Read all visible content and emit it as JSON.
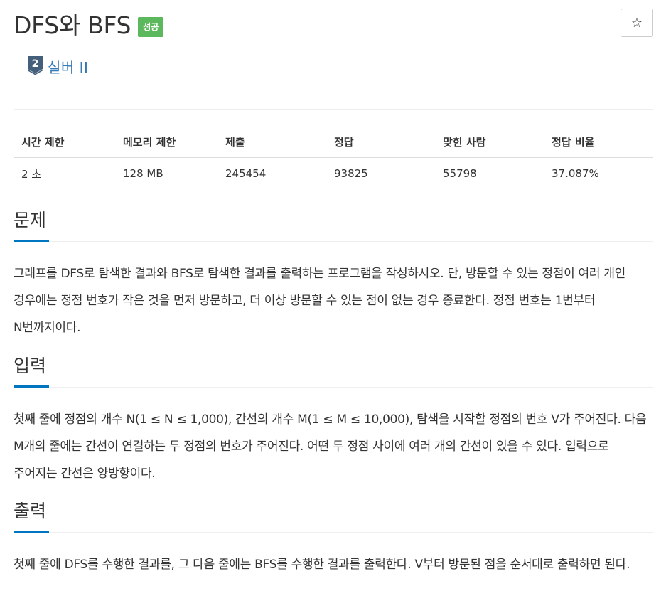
{
  "problem": {
    "title": "DFS와 BFS",
    "result_badge": "성공",
    "tier": "실버 II",
    "tier_number": "2",
    "star_label": "☆"
  },
  "info_table": {
    "headers": [
      "시간 제한",
      "메모리 제한",
      "제출",
      "정답",
      "맞힌 사람",
      "정답 비율"
    ],
    "values": [
      "2 초",
      "128 MB",
      "245454",
      "93825",
      "55798",
      "37.087%"
    ]
  },
  "sections": {
    "description": {
      "title": "문제",
      "text": "그래프를 DFS로 탐색한 결과와 BFS로 탐색한 결과를 출력하는 프로그램을 작성하시오. 단, 방문할 수 있는 정점이 여러 개인 경우에는 정점 번호가 작은 것을 먼저 방문하고, 더 이상 방문할 수 있는 점이 없는 경우 종료한다. 정점 번호는 1번부터 N번까지이다."
    },
    "input": {
      "title": "입력",
      "text": "첫째 줄에 정점의 개수 N(1 ≤ N ≤ 1,000), 간선의 개수 M(1 ≤ M ≤ 10,000), 탐색을 시작할 정점의 번호 V가 주어진다. 다음 M개의 줄에는 간선이 연결하는 두 정점의 번호가 주어진다. 어떤 두 정점 사이에 여러 개의 간선이 있을 수 있다. 입력으로 주어지는 간선은 양방향이다."
    },
    "output": {
      "title": "출력",
      "text": "첫째 줄에 DFS를 수행한 결과를, 그 다음 줄에는 BFS를 수행한 결과를 출력한다. V부터 방문된 점을 순서대로 출력하면 된다."
    }
  },
  "colors": {
    "badge_success": "#5cb85c",
    "tier_silver": "#435f7a",
    "link_blue": "#337ab7",
    "section_underline": "#0076c0"
  }
}
